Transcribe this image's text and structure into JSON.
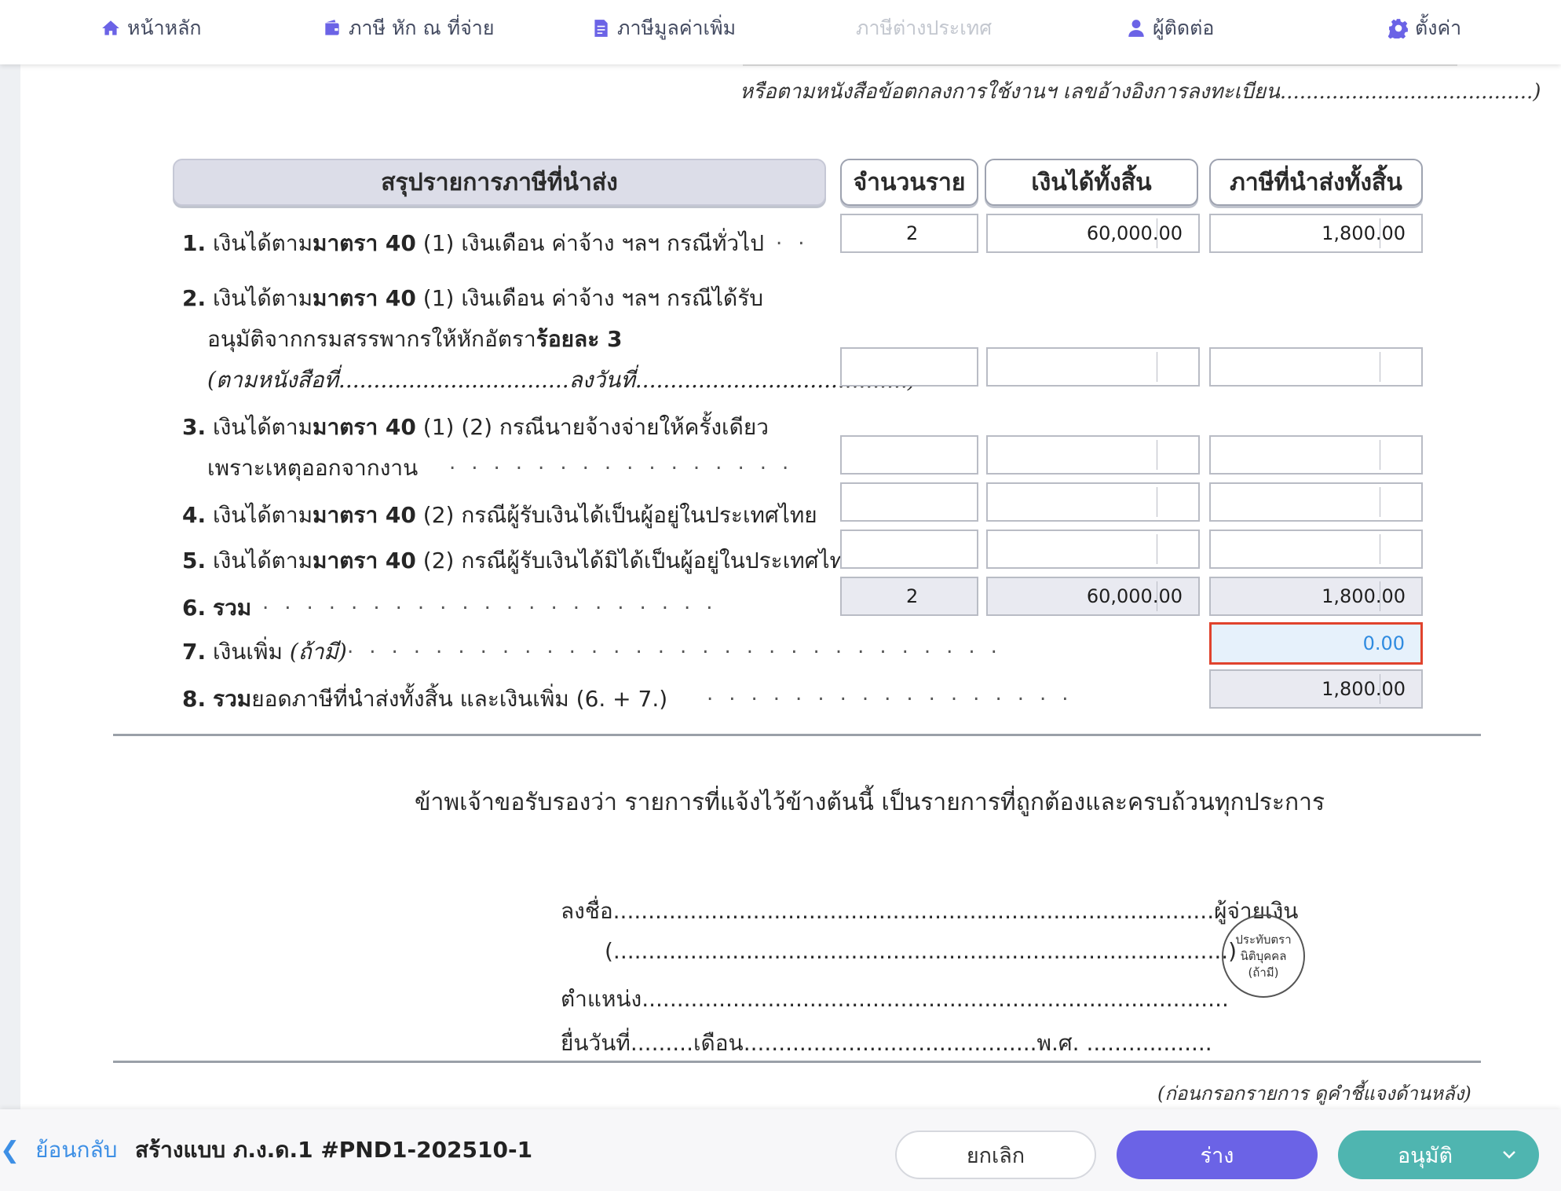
{
  "nav": {
    "items": [
      {
        "label": "หน้าหลัก",
        "icon": "home-icon"
      },
      {
        "label": "ภาษี หัก ณ ที่จ่าย",
        "icon": "wallet-icon"
      },
      {
        "label": "ภาษีมูลค่าเพิ่ม",
        "icon": "document-icon"
      },
      {
        "label": "ภาษีต่างประเทศ",
        "icon": "",
        "disabled": true
      },
      {
        "label": "ผู้ติดต่อ",
        "icon": "user-icon"
      },
      {
        "label": "ตั้งค่า",
        "icon": "gear-icon"
      }
    ]
  },
  "form": {
    "top_note": "หรือตามหนังสือข้อตกลงการใช้งานฯ เลขอ้างอิงการลงทะเบียน.......................................)",
    "headers": {
      "summary": "สรุปรายการภาษีที่นำส่ง",
      "count": "จำนวนราย",
      "income": "เงินได้ทั้งสิ้น",
      "tax": "ภาษีที่นำส่งทั้งสิ้น"
    },
    "rows": [
      {
        "num": "1.",
        "pre": "เงินได้ตาม",
        "bold": "มาตรา 40",
        "post": " (1) เงินเดือน ค่าจ้าง ฯลฯ กรณีทั่วไป",
        "count": "2",
        "income": "60,000.00",
        "tax": "1,800.00"
      },
      {
        "num": "2.",
        "pre": "เงินได้ตาม",
        "bold": "มาตรา 40",
        "post": " (1) เงินเดือน ค่าจ้าง ฯลฯ กรณีได้รับ",
        "line2_pre": "อนุมัติจากกรมสรรพากรให้หักอัตรา",
        "line2_bold": "ร้อยละ 3",
        "line3": "(ตามหนังสือที่.................................ลงวันที่.......................................)",
        "count": "",
        "income": "",
        "tax": ""
      },
      {
        "num": "3.",
        "pre": "เงินได้ตาม",
        "bold": "มาตรา 40",
        "post": " (1) (2) กรณีนายจ้างจ่ายให้ครั้งเดียว",
        "line2": "เพราะเหตุออกจากงาน",
        "count": "",
        "income": "",
        "tax": ""
      },
      {
        "num": "4.",
        "pre": "เงินได้ตาม",
        "bold": "มาตรา 40",
        "post": " (2) กรณีผู้รับเงินได้เป็นผู้อยู่ในประเทศไทย",
        "count": "",
        "income": "",
        "tax": ""
      },
      {
        "num": "5.",
        "pre": "เงินได้ตาม",
        "bold": "มาตรา 40",
        "post": " (2) กรณีผู้รับเงินได้มิได้เป็นผู้อยู่ในประเทศไทย",
        "count": "",
        "income": "",
        "tax": ""
      },
      {
        "num": "6.",
        "bold": "รวม",
        "count": "2",
        "income": "60,000.00",
        "tax": "1,800.00"
      }
    ],
    "surcharge": {
      "num": "7.",
      "pre": "เงินเพิ่ม ",
      "italic": "(ถ้ามี)",
      "value": "0.00"
    },
    "grand_total": {
      "num": "8.",
      "bold": "รวม",
      "post": "ยอดภาษีที่นำส่งทั้งสิ้น และเงินเพิ่ม (6. + 7.)",
      "value": "1,800.00"
    },
    "certification": "ข้าพเจ้าขอรับรองว่า รายการที่แจ้งไว้ข้างต้นนี้ เป็นรายการที่ถูกต้องและครบถ้วนทุกประการ",
    "signature": {
      "sign_label": "ลงชื่อ",
      "sign_dots": "......................................................................................",
      "payer_label": "ผู้จ่ายเงิน",
      "name_line": "(........................................................................................)",
      "position_label": "ตำแหน่ง",
      "position_dots": "....................................................................................",
      "date_label": "ยื่นวันที่",
      "date_dots": ".........",
      "month_label": "เดือน",
      "month_dots": "..........................................",
      "year_label": "พ.ศ.",
      "year_dots": ".................."
    },
    "stamp": {
      "line1": "ประทับตรา",
      "line2": "นิติบุคคล",
      "line3": "(ถ้ามี)"
    },
    "footer_note": "(ก่อนกรอกรายการ ดูคำชี้แจงด้านหลัง)"
  },
  "bottom": {
    "back_label": "ย้อนกลับ",
    "title": "สร้างแบบ ภ.ง.ด.1 #PND1-202510-1",
    "cancel_label": "ยกเลิก",
    "draft_label": "ร่าง",
    "approve_label": "อนุมัติ"
  },
  "colors": {
    "accent": "#6b63e6",
    "approve": "#4fb5b0",
    "link": "#3d8fe5",
    "highlight_border": "#e0432d"
  }
}
